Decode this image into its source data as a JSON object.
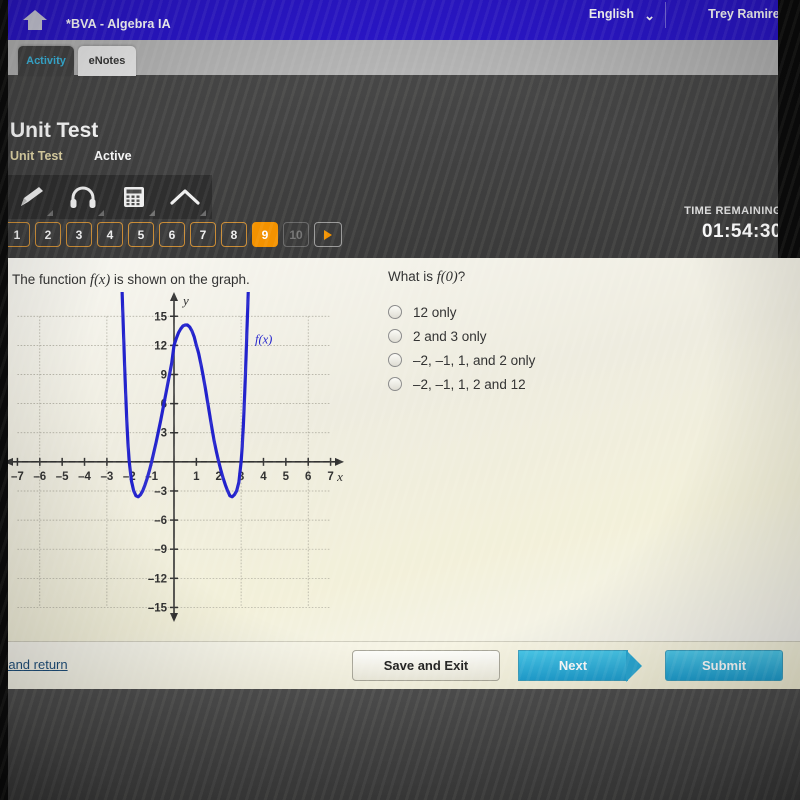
{
  "topbar": {
    "home_icon": "home-icon",
    "course_title": "*BVA - Algebra IA",
    "language": "English",
    "caret": "⌄",
    "user_name": "Trey Ramirez"
  },
  "tabs": [
    {
      "label": "Activity",
      "active": true
    },
    {
      "label": "eNotes",
      "active": false
    }
  ],
  "assignment": {
    "title": "Unit Test",
    "subtitle": "Unit Test",
    "status": "Active"
  },
  "tools": [
    {
      "name": "pencil-icon",
      "label": "Highlighter"
    },
    {
      "name": "headphones-icon",
      "label": "Read Aloud"
    },
    {
      "name": "calculator-icon",
      "label": "Calculator"
    },
    {
      "name": "chevron-up-icon",
      "label": "More Tools"
    }
  ],
  "timer": {
    "label": "TIME REMAINING",
    "value": "01:54:30"
  },
  "pager": {
    "questions": [
      {
        "label": "1",
        "state": "visited"
      },
      {
        "label": "2",
        "state": "visited"
      },
      {
        "label": "3",
        "state": "visited"
      },
      {
        "label": "4",
        "state": "visited"
      },
      {
        "label": "5",
        "state": "visited"
      },
      {
        "label": "6",
        "state": "visited"
      },
      {
        "label": "7",
        "state": "visited"
      },
      {
        "label": "8",
        "state": "visited"
      },
      {
        "label": "9",
        "state": "current"
      },
      {
        "label": "10",
        "state": "disabled"
      }
    ],
    "next_arrow": "play-triangle-icon"
  },
  "main": {
    "prompt_before": "The function ",
    "prompt_fx": "f(x)",
    "prompt_after": " is shown on the graph.",
    "question_before": "What is ",
    "question_fx": "f(0)",
    "question_after": "?",
    "choices": [
      {
        "label": "12 only",
        "selected": false
      },
      {
        "label": "2 and 3 only",
        "selected": false
      },
      {
        "label": "–2, –1, 1, and 2 only",
        "selected": false
      },
      {
        "label": "–2, –1, 1, 2 and 12",
        "selected": false
      }
    ]
  },
  "chart_data": {
    "type": "line",
    "title": "",
    "xlabel": "x",
    "ylabel": "y",
    "xlim": [
      -7.6,
      7.6
    ],
    "ylim": [
      -16.5,
      17.5
    ],
    "xticks": [
      -7,
      -6,
      -5,
      -4,
      -3,
      -2,
      -1,
      1,
      2,
      3,
      4,
      5,
      6,
      7
    ],
    "yticks": [
      15,
      12,
      9,
      6,
      3,
      -3,
      -6,
      -9,
      -12,
      -15
    ],
    "xtick_labels": [
      "–7",
      "–6",
      "–5",
      "–4",
      "–3",
      "–2",
      "–1",
      "1",
      "2",
      "3",
      "4",
      "5",
      "6",
      "7"
    ],
    "ytick_labels": [
      "15",
      "12",
      "9",
      "6",
      "3",
      "–3",
      "–6",
      "–9",
      "–12",
      "–15"
    ],
    "grid": true,
    "grid_step": 3,
    "grid_xrange": [
      -7,
      7
    ],
    "grid_yrange": [
      -15,
      15
    ],
    "series": [
      {
        "name": "f(x)",
        "color": "#2222cc",
        "annotation": "f(x)",
        "annotation_at": [
          3.62,
          12.2
        ],
        "roots": [
          -2,
          -1,
          2,
          3
        ],
        "y_intercept": 12,
        "local_maximum": [
          0.5,
          14.1
        ],
        "local_minima": [
          [
            -1.55,
            -3.6
          ],
          [
            2.55,
            -3.6
          ]
        ],
        "equation": "(x+2)(x+1)(x-2)(x-3)",
        "points": [
          [
            -2.32,
            17.5
          ],
          [
            -2.25,
            12.8
          ],
          [
            -2.2,
            9.4
          ],
          [
            -2.15,
            6.4
          ],
          [
            -2.1,
            3.7
          ],
          [
            -2.05,
            1.6
          ],
          [
            -2.0,
            0.0
          ],
          [
            -1.9,
            -2.0
          ],
          [
            -1.8,
            -3.0
          ],
          [
            -1.7,
            -3.5
          ],
          [
            -1.6,
            -3.6
          ],
          [
            -1.5,
            -3.4
          ],
          [
            -1.4,
            -3.0
          ],
          [
            -1.3,
            -2.4
          ],
          [
            -1.2,
            -1.7
          ],
          [
            -1.1,
            -0.9
          ],
          [
            -1.0,
            0.0
          ],
          [
            -0.9,
            1.0
          ],
          [
            -0.8,
            2.0
          ],
          [
            -0.7,
            3.1
          ],
          [
            -0.6,
            4.2
          ],
          [
            -0.5,
            5.4
          ],
          [
            -0.4,
            6.6
          ],
          [
            -0.3,
            7.8
          ],
          [
            -0.2,
            9.0
          ],
          [
            -0.1,
            10.2
          ],
          [
            0.0,
            12.0
          ],
          [
            0.1,
            12.7
          ],
          [
            0.2,
            13.3
          ],
          [
            0.3,
            13.7
          ],
          [
            0.4,
            14.0
          ],
          [
            0.5,
            14.1
          ],
          [
            0.6,
            14.1
          ],
          [
            0.7,
            13.9
          ],
          [
            0.8,
            13.5
          ],
          [
            0.9,
            12.9
          ],
          [
            1.0,
            12.0
          ],
          [
            1.1,
            11.2
          ],
          [
            1.2,
            10.1
          ],
          [
            1.3,
            8.9
          ],
          [
            1.4,
            7.6
          ],
          [
            1.5,
            6.2
          ],
          [
            1.6,
            4.8
          ],
          [
            1.7,
            3.4
          ],
          [
            1.8,
            2.1
          ],
          [
            1.9,
            1.0
          ],
          [
            2.0,
            0.0
          ],
          [
            2.1,
            -0.9
          ],
          [
            2.2,
            -1.7
          ],
          [
            2.3,
            -2.4
          ],
          [
            2.4,
            -3.0
          ],
          [
            2.5,
            -3.5
          ],
          [
            2.6,
            -3.6
          ],
          [
            2.7,
            -3.4
          ],
          [
            2.8,
            -3.0
          ],
          [
            2.9,
            -2.1
          ],
          [
            3.0,
            0.0
          ],
          [
            3.05,
            1.6
          ],
          [
            3.1,
            3.7
          ],
          [
            3.15,
            6.4
          ],
          [
            3.2,
            9.4
          ],
          [
            3.25,
            12.8
          ],
          [
            3.32,
            17.5
          ]
        ]
      }
    ]
  },
  "actions": {
    "mark_link": "Mark this and return",
    "save_exit": "Save and Exit",
    "next": "Next",
    "submit": "Submit"
  }
}
